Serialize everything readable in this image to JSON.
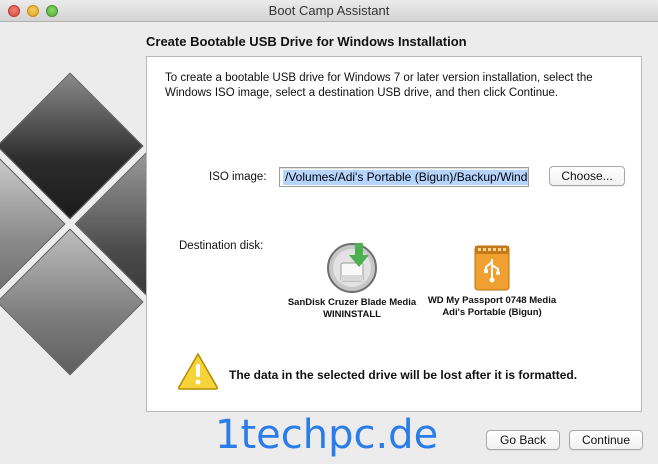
{
  "window": {
    "title": "Boot Camp Assistant"
  },
  "heading": "Create Bootable USB Drive for Windows Installation",
  "instructions": "To create a bootable USB drive for Windows 7 or later version installation, select the Windows ISO image, select a destination USB drive, and then click Continue.",
  "iso": {
    "label": "ISO image:",
    "value": "/Volumes/Adi's Portable (Bigun)/Backup/Wind",
    "choose_label": "Choose..."
  },
  "destination": {
    "label": "Destination disk:",
    "disks": [
      {
        "name": "SanDisk Cruzer Blade Media",
        "volume": "WININSTALL",
        "icon": "usb-drive-icon",
        "selected": true
      },
      {
        "name": "WD My Passport 0748 Media",
        "volume": "Adi's Portable (Bigun)",
        "icon": "external-usb-hdd-icon",
        "selected": false
      }
    ]
  },
  "warning": {
    "text": "The data in the selected drive will be lost after it is formatted.",
    "icon": "warning-icon"
  },
  "watermark": "1techpc.de",
  "buttons": {
    "go_back": "Go Back",
    "continue": "Continue"
  },
  "colors": {
    "selection": "#b5d5ff",
    "watermark": "#1a73e8",
    "usb_arrow": "#4caf50",
    "hdd": "#f0a030"
  }
}
